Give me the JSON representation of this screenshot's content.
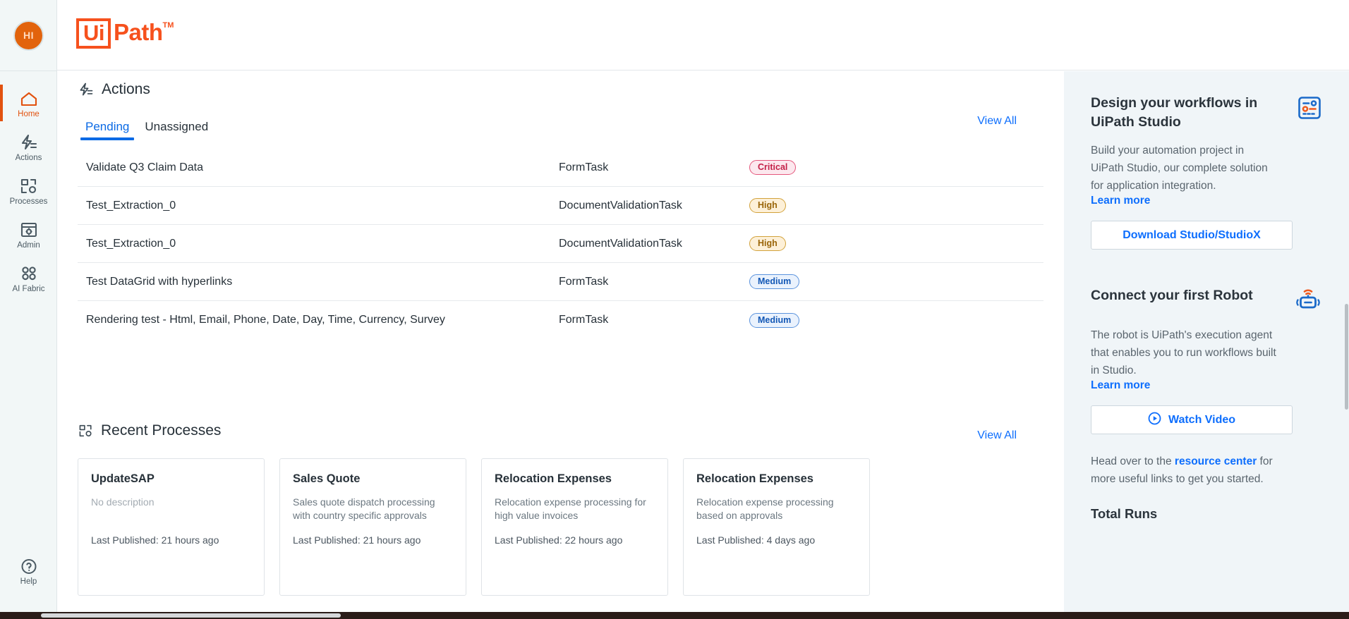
{
  "brand": {
    "logo_ui": "Ui",
    "logo_path": "Path",
    "logo_tm": "TM",
    "accent_orange": "#f6511d",
    "accent_blue": "#0d6efd",
    "rail_bg": "#f2f7f7",
    "panel_bg": "#f0f5f8"
  },
  "user": {
    "avatar_initials": "HI"
  },
  "sidebar": {
    "items": [
      {
        "label": "Home",
        "icon": "home-icon",
        "active": true
      },
      {
        "label": "Actions",
        "icon": "actions-bolt-icon",
        "active": false
      },
      {
        "label": "Processes",
        "icon": "processes-icon",
        "active": false
      },
      {
        "label": "Admin",
        "icon": "admin-icon",
        "active": false
      },
      {
        "label": "AI Fabric",
        "icon": "ai-fabric-icon",
        "active": false
      }
    ],
    "help_label": "Help",
    "help_icon": "question-circle-icon"
  },
  "actions": {
    "title": "Actions",
    "icon": "actions-bolt-icon",
    "view_all_label": "View All",
    "tabs": [
      {
        "label": "Pending",
        "active": true
      },
      {
        "label": "Unassigned",
        "active": false
      }
    ],
    "rows": [
      {
        "name": "Validate Q3 Claim Data",
        "type": "FormTask",
        "priority": "Critical",
        "priority_class": "critical"
      },
      {
        "name": "Test_Extraction_0",
        "type": "DocumentValidationTask",
        "priority": "High",
        "priority_class": "high"
      },
      {
        "name": "Test_Extraction_0",
        "type": "DocumentValidationTask",
        "priority": "High",
        "priority_class": "high"
      },
      {
        "name": "Test DataGrid with hyperlinks",
        "type": "FormTask",
        "priority": "Medium",
        "priority_class": "medium"
      },
      {
        "name": "Rendering test - Html, Email, Phone, Date, Day, Time, Currency, Survey",
        "type": "FormTask",
        "priority": "Medium",
        "priority_class": "medium"
      }
    ]
  },
  "recent_processes": {
    "title": "Recent Processes",
    "icon": "processes-icon",
    "view_all_label": "View All",
    "cards": [
      {
        "title": "UpdateSAP",
        "description": "No description",
        "empty": true,
        "published": "Last Published: 21 hours ago"
      },
      {
        "title": "Sales Quote",
        "description": "Sales quote dispatch processing with country specific approvals",
        "empty": false,
        "published": "Last Published: 21 hours ago"
      },
      {
        "title": "Relocation Expenses",
        "description": "Relocation expense processing for high value invoices",
        "empty": false,
        "published": "Last Published: 22 hours ago"
      },
      {
        "title": "Relocation Expenses",
        "description": "Relocation expense processing based on approvals",
        "empty": false,
        "published": "Last Published: 4 days ago"
      }
    ]
  },
  "right_panel": {
    "studio": {
      "title": "Design your workflows in UiPath Studio",
      "body": "Build your automation project in UiPath Studio, our complete solution for application integration.",
      "link_label": "Learn more",
      "button_label": "Download Studio/StudioX",
      "icon": "studio-board-icon"
    },
    "robot": {
      "title": "Connect your first Robot",
      "body": "The robot is UiPath's execution agent that enables you to run workflows built in Studio.",
      "link_label": "Learn more",
      "button_label": "Watch Video",
      "button_icon": "play-circle-icon",
      "icon": "robot-icon"
    },
    "footnote_pre": "Head over to the ",
    "footnote_link": "resource center",
    "footnote_post": " for more useful links to get you started.",
    "total_runs_label": "Total Runs"
  }
}
